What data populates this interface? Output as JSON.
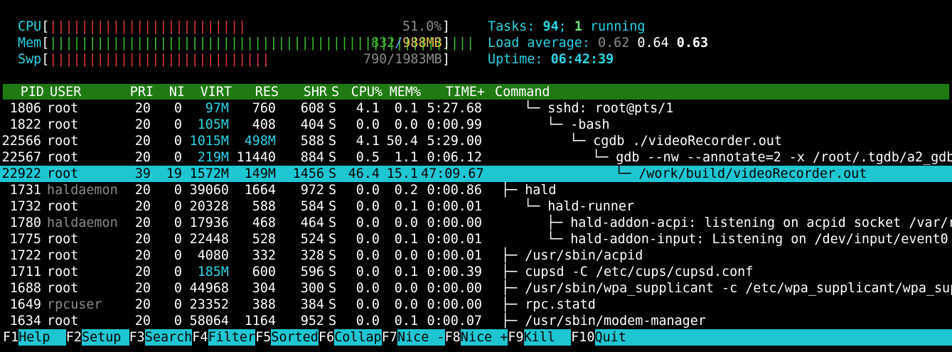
{
  "meters": {
    "cpu": {
      "label": "CPU",
      "bars": "|||||||||||||||||||||||||",
      "value": "51.0%",
      "percent": 51.0
    },
    "mem": {
      "label": "Mem",
      "bars": "||||||||||||||||||||||||||||||||||||||||||||||||||||||",
      "value_used": "832",
      "value_sep": "/",
      "value_total": "988MB"
    },
    "swp": {
      "label": "Swp",
      "bars": "||||||||||||||||||||||||||||",
      "value": "790/1983MB"
    }
  },
  "summary": {
    "tasks_label": "Tasks:",
    "tasks_total": "94",
    "tasks_sep": ";",
    "tasks_running": "1",
    "tasks_running_label": "running",
    "load_label": "Load average:",
    "load_1": "0.62",
    "load_5": "0.64",
    "load_15": "0.63",
    "uptime_label": "Uptime:",
    "uptime": "06:42:39"
  },
  "columns": {
    "pid": "PID",
    "user": "USER",
    "pri": "PRI",
    "ni": "NI",
    "virt": "VIRT",
    "res": "RES",
    "shr": "SHR",
    "s": "S",
    "cpu": "CPU%",
    "mem": "MEM%",
    "time": "TIME+",
    "command": "Command"
  },
  "processes": [
    {
      "pid": "1806",
      "user": "root",
      "pri": "20",
      "ni": "0",
      "virt": "97M",
      "res": "760",
      "shr": "608",
      "s": "S",
      "cpu": "4.1",
      "mem": "0.1",
      "time": "5:27.68",
      "tree": "└─ ",
      "indent": 1,
      "command": "sshd: root@pts/1"
    },
    {
      "pid": "1822",
      "user": "root",
      "pri": "20",
      "ni": "0",
      "virt": "105M",
      "res": "408",
      "shr": "404",
      "s": "S",
      "cpu": "0.0",
      "mem": "0.0",
      "time": "0:00.99",
      "tree": "└─ ",
      "indent": 2,
      "command": "-bash"
    },
    {
      "pid": "22566",
      "user": "root",
      "pri": "20",
      "ni": "0",
      "virt": "1015M",
      "res": "498M",
      "shr": "588",
      "s": "S",
      "cpu": "4.1",
      "mem": "50.4",
      "time": "5:29.00",
      "tree": "└─ ",
      "indent": 3,
      "command": "cgdb ./videoRecorder.out"
    },
    {
      "pid": "22567",
      "user": "root",
      "pri": "20",
      "ni": "0",
      "virt": "219M",
      "res": "11440",
      "shr": "884",
      "s": "S",
      "cpu": "0.5",
      "mem": "1.1",
      "time": "0:06.12",
      "tree": "└─ ",
      "indent": 4,
      "command": "gdb --nw --annotate=2 -x /root/.tgdb/a2_gdb"
    },
    {
      "pid": "22922",
      "user": "root",
      "pri": "39",
      "ni": "19",
      "virt": "1572M",
      "res": "149M",
      "shr": "1456",
      "s": "S",
      "cpu": "46.4",
      "mem": "15.1",
      "time": "47:09.67",
      "tree": "└─ ",
      "indent": 5,
      "command": "/work/build/videoRecorder.out",
      "selected": true
    },
    {
      "pid": "1731",
      "user": "haldaemon",
      "pri": "20",
      "ni": "0",
      "virt": "39060",
      "res": "1664",
      "shr": "972",
      "s": "S",
      "cpu": "0.0",
      "mem": "0.2",
      "time": "0:00.86",
      "tree": "├─ ",
      "indent": 0,
      "command": "hald"
    },
    {
      "pid": "1732",
      "user": "root",
      "pri": "20",
      "ni": "0",
      "virt": "20328",
      "res": "588",
      "shr": "584",
      "s": "S",
      "cpu": "0.0",
      "mem": "0.1",
      "time": "0:00.01",
      "tree": "└─ ",
      "indent": 1,
      "command": "hald-runner"
    },
    {
      "pid": "1780",
      "user": "haldaemon",
      "pri": "20",
      "ni": "0",
      "virt": "17936",
      "res": "468",
      "shr": "464",
      "s": "S",
      "cpu": "0.0",
      "mem": "0.0",
      "time": "0:00.00",
      "tree": "├─ ",
      "indent": 2,
      "command": "hald-addon-acpi: listening on acpid socket /var/r"
    },
    {
      "pid": "1775",
      "user": "root",
      "pri": "20",
      "ni": "0",
      "virt": "22448",
      "res": "528",
      "shr": "524",
      "s": "S",
      "cpu": "0.0",
      "mem": "0.1",
      "time": "0:00.01",
      "tree": "└─ ",
      "indent": 2,
      "command": "hald-addon-input: Listening on /dev/input/event0"
    },
    {
      "pid": "1722",
      "user": "root",
      "pri": "20",
      "ni": "0",
      "virt": "4080",
      "res": "332",
      "shr": "328",
      "s": "S",
      "cpu": "0.0",
      "mem": "0.0",
      "time": "0:00.01",
      "tree": "├─ ",
      "indent": 0,
      "command": "/usr/sbin/acpid"
    },
    {
      "pid": "1711",
      "user": "root",
      "pri": "20",
      "ni": "0",
      "virt": "185M",
      "res": "600",
      "shr": "596",
      "s": "S",
      "cpu": "0.0",
      "mem": "0.1",
      "time": "0:00.39",
      "tree": "├─ ",
      "indent": 0,
      "command": "cupsd -C /etc/cups/cupsd.conf"
    },
    {
      "pid": "1688",
      "user": "root",
      "pri": "20",
      "ni": "0",
      "virt": "44968",
      "res": "304",
      "shr": "300",
      "s": "S",
      "cpu": "0.0",
      "mem": "0.0",
      "time": "0:00.00",
      "tree": "├─ ",
      "indent": 0,
      "command": "/usr/sbin/wpa_supplicant -c /etc/wpa_supplicant/wpa_sup"
    },
    {
      "pid": "1649",
      "user": "rpcuser",
      "pri": "20",
      "ni": "0",
      "virt": "23352",
      "res": "388",
      "shr": "384",
      "s": "S",
      "cpu": "0.0",
      "mem": "0.0",
      "time": "0:00.00",
      "tree": "├─ ",
      "indent": 0,
      "command": "rpc.statd"
    },
    {
      "pid": "1634",
      "user": "root",
      "pri": "20",
      "ni": "0",
      "virt": "58064",
      "res": "1164",
      "shr": "952",
      "s": "S",
      "cpu": "0.0",
      "mem": "0.1",
      "time": "0:00.07",
      "tree": "├─ ",
      "indent": 0,
      "command": "/usr/sbin/modem-manager"
    }
  ],
  "function_keys": [
    {
      "key": "F1",
      "label": "Help  "
    },
    {
      "key": "F2",
      "label": "Setup "
    },
    {
      "key": "F3",
      "label": "Search"
    },
    {
      "key": "F4",
      "label": "Filter"
    },
    {
      "key": "F5",
      "label": "Sorted"
    },
    {
      "key": "F6",
      "label": "Collap"
    },
    {
      "key": "F7",
      "label": "Nice -"
    },
    {
      "key": "F8",
      "label": "Nice +"
    },
    {
      "key": "F9",
      "label": "Kill  "
    },
    {
      "key": "F10",
      "label": "Quit"
    }
  ],
  "colors": {
    "header_bg": "#1f7a12",
    "selected_bg": "#1ec6d2",
    "meter_label": "#2ad4e6",
    "bar_green": "#3bbf2d",
    "bar_red": "#e0333a"
  }
}
